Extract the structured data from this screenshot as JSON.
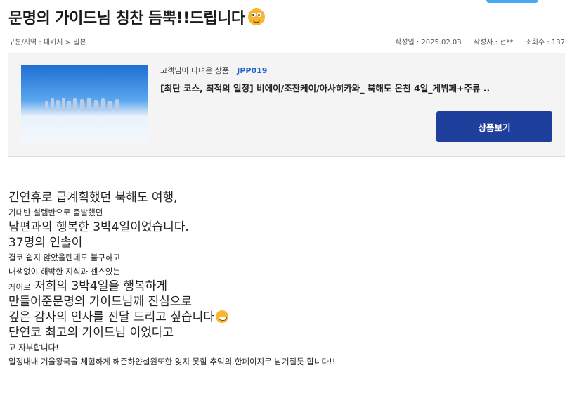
{
  "post": {
    "title": "문명의 가이드님 칭찬 듬뿍!!드립니다",
    "category": "구분/지역 : 패키지 > 일본",
    "date": "작성일 : 2025.02.03",
    "author": "작성자 : 전**",
    "views": "조회수 : 137"
  },
  "product": {
    "label": "고객님이 다녀온 상품 :",
    "code": "JPP019",
    "name": "[최단 코스, 최적의 일정] 비에이/조잔케이/아사히카와_ 북해도 온천 4일_게뷔페+주류 ..",
    "button": "상품보기"
  },
  "body": {
    "l1": "긴연휴로 급계획했던 북해도 여행,",
    "l2": "기대반 설렘반으로 출발했던",
    "l3": "남편과의 행복한 3박4일이었습니다.",
    "l4": "37명의 인솔이",
    "l5": "결코 쉽지 않았을텐데도 불구하고",
    "l6": "내색없이 해박한 지식과 센스있는",
    "l7a": "케어로",
    "l7b": " 저희의 3박4일을 행복하게",
    "l8": "만들어준문명의 가이드님께 진심으로",
    "l9": "깊은 감사의 인사를 전달 드리고 싶습니다",
    "l10": "단연코 최고의 가이드님 이었다고",
    "l11": "고 자부합니다!",
    "l12": "일정내내 겨울왕국을 체험하게 해준하얀설원또한 잊지 못할 추억의 한페이지로 남겨질듯 합니다!!"
  },
  "icons": {
    "title_emoji": "smiling-face-icon",
    "body_emoji": "grinning-face-icon"
  }
}
